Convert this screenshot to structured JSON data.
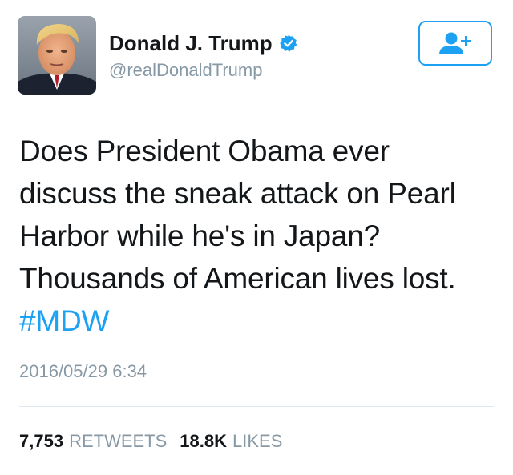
{
  "user": {
    "display_name": "Donald J. Trump",
    "handle": "@realDonaldTrump",
    "verified": true,
    "avatar_icon": "profile-photo"
  },
  "follow_button": {
    "icon": "add-user-icon",
    "color": "#1da1f2"
  },
  "tweet": {
    "text_lines": [
      "Does President Obama ever",
      "discuss the sneak attack on Pearl",
      "Harbor while he's in Japan?",
      "Thousands of American lives lost."
    ],
    "hashtag": "#MDW",
    "timestamp": "2016/05/29 6:34"
  },
  "stats": {
    "retweets_count": "7,753",
    "retweets_label": "RETWEETS",
    "likes_count": "18.8K",
    "likes_label": "LIKES"
  },
  "colors": {
    "accent": "#1da1f2",
    "muted_text": "#8899a6",
    "primary_text": "#14171a",
    "divider": "#e1e8ed"
  }
}
